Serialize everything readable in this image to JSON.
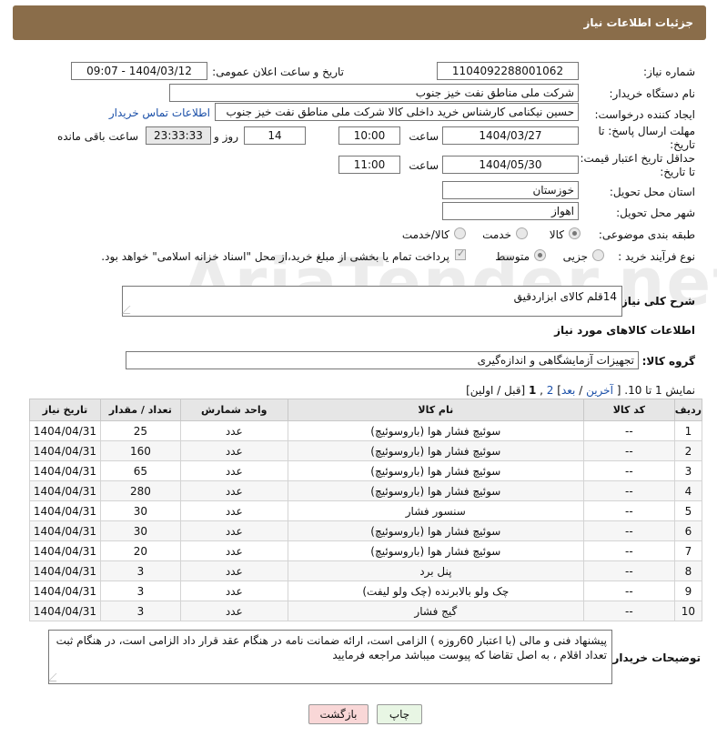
{
  "header": {
    "title": "جزئیات اطلاعات نیاز"
  },
  "fields": {
    "need_number_label": "شماره نیاز:",
    "need_number": "1104092288001062",
    "announce_label": "تاریخ و ساعت اعلان عمومی:",
    "announce_value": "1404/03/12 - 09:07",
    "buyer_org_label": "نام دستگاه خریدار:",
    "buyer_org": "شرکت ملی مناطق نفت خیز جنوب",
    "creator_label": "ایجاد کننده درخواست:",
    "creator": "حسین  نیکنامی  کارشناس خرید داخلی کالا شرکت ملی مناطق نفت خیز جنوب",
    "contact_link": "اطلاعات تماس خریدار",
    "deadline_label_1": "مهلت ارسال پاسخ: تا",
    "deadline_label_2": "تاریخ:",
    "deadline_date": "1404/03/27",
    "time_label": "ساعت",
    "deadline_time": "10:00",
    "days_value": "14",
    "days_label": "روز و",
    "remaining_value": "23:33:33",
    "remaining_label": "ساعت باقی مانده",
    "validity_label_1": "حداقل تاریخ اعتبار قیمت:",
    "validity_label_2": "تا تاریخ:",
    "validity_date": "1404/05/30",
    "validity_time": "11:00",
    "province_label": "استان محل تحویل:",
    "province": "خوزستان",
    "city_label": "شهر محل تحویل:",
    "city": "اهواز",
    "category_label": "طبقه بندی موضوعی:",
    "category_goods": "کالا",
    "category_service": "خدمت",
    "category_both": "کالا/خدمت",
    "process_label": "نوع فرآیند خرید :",
    "process_minor": "جزیی",
    "process_medium": "متوسط",
    "payment_note": "پرداخت تمام یا بخشی از مبلغ خرید،از محل \"اسناد خزانه اسلامی\" خواهد بود."
  },
  "description": {
    "label": "شرح کلی نیاز:",
    "value": "14قلم کالای ابزاردقیق"
  },
  "goods_info_title": "اطلاعات کالاهای مورد نیاز",
  "goods_group": {
    "label": "گروه کالا:",
    "value": "تجهیزات آزمایشگاهی و اندازه‌گیری"
  },
  "pagination": {
    "prefix": "نمایش 1 تا 10. [",
    "last": "آخرین",
    "sep1": " / ",
    "next": "بعد",
    "page2": "2",
    "page1": "1",
    "suffix": "[قبل / اولین]"
  },
  "table": {
    "headers": [
      "ردیف",
      "کد کالا",
      "نام کالا",
      "واحد شمارش",
      "تعداد / مقدار",
      "تاریخ نیاز"
    ],
    "rows": [
      [
        "1",
        "--",
        "سوئیچ فشار هوا (باروسوئیچ)",
        "عدد",
        "25",
        "1404/04/31"
      ],
      [
        "2",
        "--",
        "سوئیچ فشار هوا (باروسوئیچ)",
        "عدد",
        "160",
        "1404/04/31"
      ],
      [
        "3",
        "--",
        "سوئیچ فشار هوا (باروسوئیچ)",
        "عدد",
        "65",
        "1404/04/31"
      ],
      [
        "4",
        "--",
        "سوئیچ فشار هوا (باروسوئیچ)",
        "عدد",
        "280",
        "1404/04/31"
      ],
      [
        "5",
        "--",
        "سنسور فشار",
        "عدد",
        "30",
        "1404/04/31"
      ],
      [
        "6",
        "--",
        "سوئیچ فشار هوا (باروسوئیچ)",
        "عدد",
        "30",
        "1404/04/31"
      ],
      [
        "7",
        "--",
        "سوئیچ فشار هوا (باروسوئیچ)",
        "عدد",
        "20",
        "1404/04/31"
      ],
      [
        "8",
        "--",
        "پنل برد",
        "عدد",
        "3",
        "1404/04/31"
      ],
      [
        "9",
        "--",
        "چک ولو بالابرنده (چک ولو لیفت)",
        "عدد",
        "3",
        "1404/04/31"
      ],
      [
        "10",
        "--",
        "گیج فشار",
        "عدد",
        "3",
        "1404/04/31"
      ]
    ]
  },
  "buyer_notes": {
    "label": "توضیحات خریدار:",
    "value": "پیشنهاد فنی و مالی (با اعتبار 60روزه ) الزامی است، ارائه ضمانت نامه در هنگام عقد قرار داد الزامی است، در هنگام ثبت تعداد اقلام ،  به اصل تقاضا که پیوست میباشد مراجعه  فرمایید"
  },
  "buttons": {
    "print": "چاپ",
    "back": "بازگشت"
  },
  "watermark": "AriaTender.net"
}
